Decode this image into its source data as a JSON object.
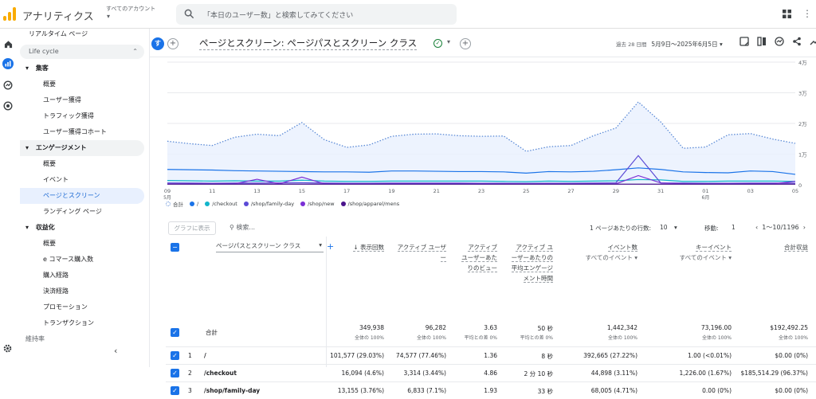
{
  "app": {
    "title": "アナリティクス",
    "account_label": "すべてのアカウント"
  },
  "search": {
    "placeholder": "「本日のユーザー数」と検索してみてください"
  },
  "sidebar": {
    "realtime": "リアルタイム ページ",
    "lifecycle": "Life cycle",
    "groups": [
      {
        "label": "集客",
        "items": [
          "概要",
          "ユーザー獲得",
          "トラフィック獲得",
          "ユーザー獲得コホート"
        ]
      },
      {
        "label": "エンゲージメント",
        "items": [
          "概要",
          "イベント",
          "ページとスクリーン",
          "ランディング ページ"
        ]
      },
      {
        "label": "収益化",
        "items": [
          "概要",
          "e コマース購入数",
          "購入経路",
          "決済経路",
          "プロモーション",
          "トランザクション"
        ]
      }
    ],
    "cutoff": "維持率"
  },
  "header": {
    "chip": "す",
    "title": "ページとスクリーン: ページパスとスクリーン クラス",
    "date_prefix": "過去 28 日間",
    "date_range": "5月9日～2025年6月5日"
  },
  "chart_data": {
    "type": "line",
    "x": [
      "09",
      "11",
      "13",
      "15",
      "17",
      "19",
      "21",
      "23",
      "25",
      "27",
      "29",
      "31",
      "01",
      "03",
      "05"
    ],
    "x_sublabels": {
      "09": "5月",
      "01": "6月"
    },
    "yticks": [
      "4万",
      "3万",
      "2万",
      "1万",
      "0"
    ],
    "ylim": [
      0,
      40000
    ],
    "series": [
      {
        "name": "合計",
        "color": "#5b8ad6",
        "style": "dotted",
        "values": [
          14200,
          13400,
          12800,
          15500,
          16500,
          16000,
          20300,
          14700,
          12200,
          13000,
          15800,
          16500,
          16600,
          16000,
          15800,
          15900,
          10900,
          12400,
          12800,
          16000,
          18500,
          27000,
          20500,
          11900,
          12300,
          16300,
          16700,
          14900,
          13500
        ]
      },
      {
        "name": "/",
        "color": "#1a73e8",
        "style": "solid",
        "values": [
          5000,
          4900,
          4800,
          4600,
          4500,
          4400,
          4300,
          4200,
          4200,
          4100,
          4500,
          4500,
          4400,
          4300,
          4300,
          4200,
          3800,
          4300,
          4200,
          4400,
          4900,
          5500,
          5000,
          4200,
          4000,
          3900,
          4500,
          4300,
          3400
        ]
      },
      {
        "name": "/checkout",
        "color": "#12b5cb",
        "style": "solid",
        "values": [
          1400,
          1300,
          1200,
          1300,
          1200,
          1200,
          1500,
          1200,
          1100,
          1100,
          1200,
          1200,
          1200,
          1200,
          1200,
          1100,
          1000,
          1200,
          1100,
          1200,
          1300,
          1700,
          1600,
          1100,
          1100,
          1200,
          1200,
          1200,
          1100
        ]
      },
      {
        "name": "/shop/family-day",
        "color": "#5b4ad6",
        "style": "solid",
        "values": [
          600,
          550,
          500,
          550,
          550,
          600,
          650,
          550,
          500,
          500,
          550,
          550,
          550,
          550,
          500,
          500,
          450,
          500,
          500,
          550,
          600,
          9500,
          600,
          550,
          500,
          500,
          550,
          550,
          500
        ]
      },
      {
        "name": "/shop/new",
        "color": "#7b2fd6",
        "style": "solid",
        "values": [
          300,
          300,
          300,
          300,
          1800,
          300,
          2500,
          300,
          300,
          300,
          300,
          300,
          300,
          300,
          300,
          300,
          300,
          300,
          300,
          300,
          300,
          3000,
          600,
          300,
          300,
          300,
          300,
          300,
          1100
        ]
      },
      {
        "name": "/shop/apparel/mens",
        "color": "#4a148c",
        "style": "solid",
        "values": [
          200,
          200,
          200,
          200,
          200,
          200,
          200,
          200,
          200,
          200,
          200,
          200,
          200,
          200,
          200,
          200,
          200,
          200,
          200,
          200,
          200,
          200,
          200,
          200,
          200,
          200,
          200,
          200,
          200
        ]
      }
    ]
  },
  "table_toolbar": {
    "graph_button": "グラフに表示",
    "search": "検索...",
    "rows_label": "1 ページあたりの行数:",
    "rows_value": "10",
    "move_label": "移動:",
    "move_value": "1",
    "pager": "1～10/1196"
  },
  "table": {
    "dimension": "ページパスとスクリーン クラス",
    "columns": [
      {
        "label": "↓ 表示回数",
        "sub": ""
      },
      {
        "label": "アクティブ ユーザー",
        "sub": ""
      },
      {
        "label": "アクティブ ユーザーあたりのビュー",
        "sub": ""
      },
      {
        "label": "アクティブ ユーザーあたりの平均エンゲージメント時間",
        "sub": ""
      },
      {
        "label": "イベント数",
        "sub": "すべてのイベント ▾"
      },
      {
        "label": "キーイベント",
        "sub": "すべてのイベント ▾"
      },
      {
        "label": "合計収益",
        "sub": ""
      }
    ],
    "totals": {
      "label": "合計",
      "values": [
        "349,938",
        "96,282",
        "3.63",
        "50 秒",
        "1,442,342",
        "73,196.00",
        "$192,492.25"
      ],
      "subs": [
        "全体の 100%",
        "全体の 100%",
        "平均との差 0%",
        "平均との差 0%",
        "全体の 100%",
        "全体の 100%",
        "全体の 100%"
      ]
    },
    "rows": [
      {
        "idx": "1",
        "path": "/",
        "values": [
          "101,577 (29.03%)",
          "74,577 (77.46%)",
          "1.36",
          "8 秒",
          "392,665 (27.22%)",
          "1.00 (<0.01%)",
          "$0.00 (0%)"
        ]
      },
      {
        "idx": "2",
        "path": "/checkout",
        "values": [
          "16,094 (4.6%)",
          "3,314 (3.44%)",
          "4.86",
          "2 分 10 秒",
          "44,898 (3.11%)",
          "1,226.00 (1.67%)",
          "$185,514.29 (96.37%)"
        ]
      },
      {
        "idx": "3",
        "path": "/shop/family-day",
        "values": [
          "13,155 (3.76%)",
          "6,833 (7.1%)",
          "1.93",
          "33 秒",
          "68,005 (4.71%)",
          "0.00 (0%)",
          "$0.00 (0%)"
        ]
      }
    ]
  }
}
